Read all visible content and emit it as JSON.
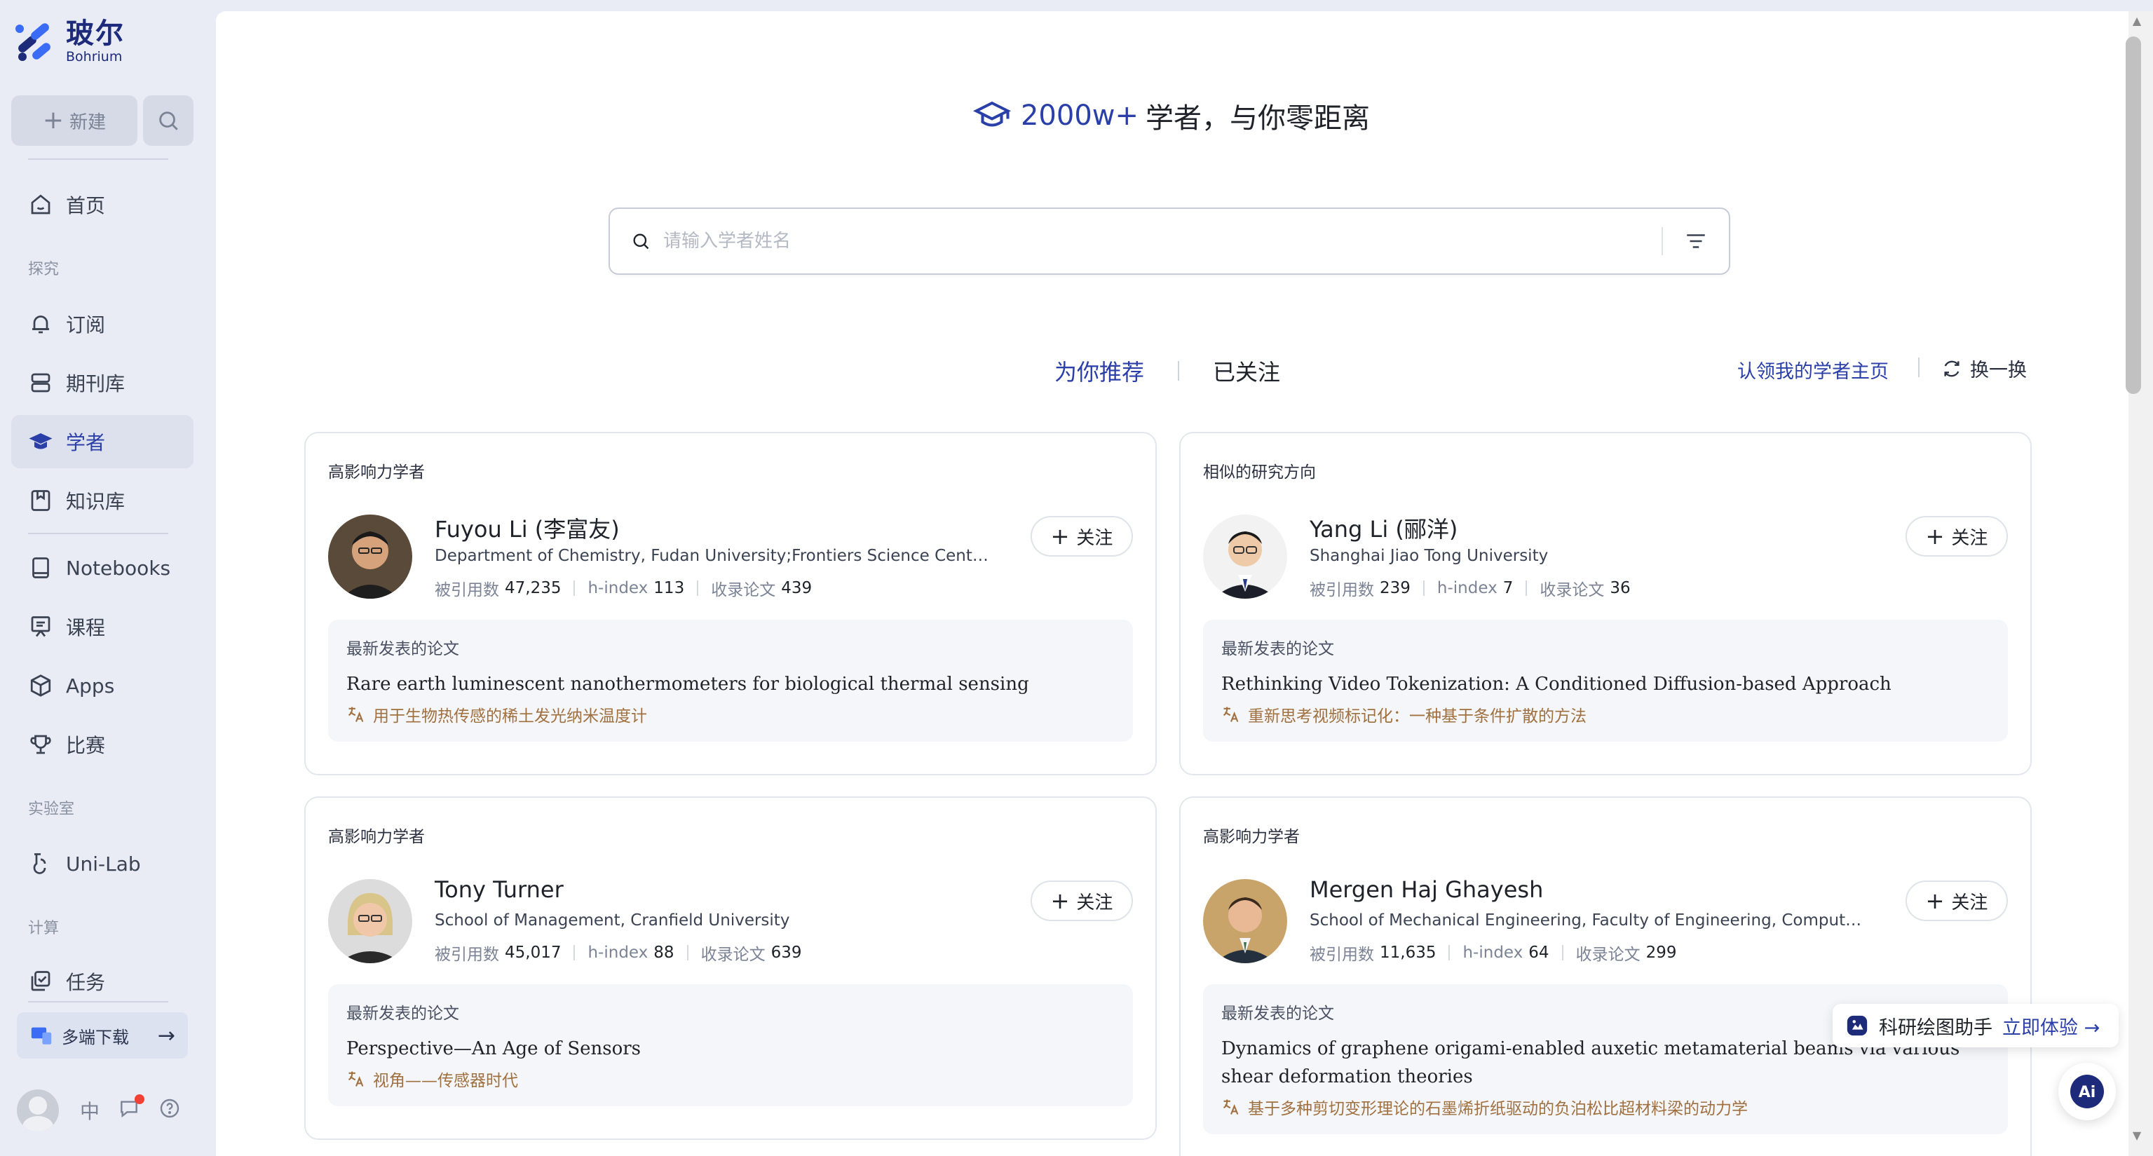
{
  "brand": {
    "name_cn": "玻尔",
    "name_en": "Bohrium"
  },
  "sidebar": {
    "new_label": "新建",
    "home": "首页",
    "section_explore": "探究",
    "subscribe": "订阅",
    "journals": "期刊库",
    "scholars": "学者",
    "knowledge": "知识库",
    "notebooks": "Notebooks",
    "courses": "课程",
    "apps": "Apps",
    "contests": "比赛",
    "section_lab": "实验室",
    "unilab": "Uni-Lab",
    "section_compute": "计算",
    "tasks": "任务",
    "download": "多端下载",
    "lang": "中"
  },
  "hero": {
    "count": "2000w+",
    "text": "学者，与你零距离"
  },
  "search": {
    "placeholder": "请输入学者姓名",
    "value": ""
  },
  "tabs": {
    "recommended": "为你推荐",
    "following": "已关注"
  },
  "claim_link": "认领我的学者主页",
  "refresh_label": "换一换",
  "cards": [
    {
      "tag": "高影响力学者",
      "name": "Fuyou Li (李富友)",
      "affiliation": "Department of Chemistry, Fudan University;Frontiers Science Center for...",
      "citations_label": "被引用数",
      "citations": "47,235",
      "hindex_label": "h-index",
      "hindex": "113",
      "papers_label": "收录论文",
      "papers": "439",
      "follow": "关注",
      "paper_head": "最新发表的论文",
      "paper_title": "Rare earth luminescent nanothermometers for biological thermal sensing",
      "paper_translation": "用于生物热传感的稀土发光纳米温度计"
    },
    {
      "tag": "相似的研究方向",
      "name": "Yang Li (郦洋)",
      "affiliation": "Shanghai Jiao Tong University",
      "citations_label": "被引用数",
      "citations": "239",
      "hindex_label": "h-index",
      "hindex": "7",
      "papers_label": "收录论文",
      "papers": "36",
      "follow": "关注",
      "paper_head": "最新发表的论文",
      "paper_title": "Rethinking Video Tokenization: A Conditioned Diffusion-based Approach",
      "paper_translation": "重新思考视频标记化：一种基于条件扩散的方法"
    },
    {
      "tag": "高影响力学者",
      "name": "Tony Turner",
      "affiliation": "School of Management, Cranfield University",
      "citations_label": "被引用数",
      "citations": "45,017",
      "hindex_label": "h-index",
      "hindex": "88",
      "papers_label": "收录论文",
      "papers": "639",
      "follow": "关注",
      "paper_head": "最新发表的论文",
      "paper_title": "Perspective—An Age of Sensors",
      "paper_translation": "视角——传感器时代"
    },
    {
      "tag": "高影响力学者",
      "name": "Mergen Haj Ghayesh",
      "affiliation": "School of Mechanical Engineering, Faculty of Engineering, Computer and...",
      "citations_label": "被引用数",
      "citations": "11,635",
      "hindex_label": "h-index",
      "hindex": "64",
      "papers_label": "收录论文",
      "papers": "299",
      "follow": "关注",
      "paper_head": "最新发表的论文",
      "paper_title": "Dynamics of graphene origami-enabled auxetic metamaterial beams via various shear deformation theories",
      "paper_translation": "基于多种剪切变形理论的石墨烯折纸驱动的负泊松比超材料梁的动力学"
    }
  ],
  "float_helper": {
    "label": "科研绘图助手",
    "cta": "立即体验 →"
  },
  "ai_button": "Ai",
  "colors": {
    "accent": "#2b3fa8",
    "sidebar_bg": "#e9ecf5",
    "translation": "#a0703f"
  }
}
